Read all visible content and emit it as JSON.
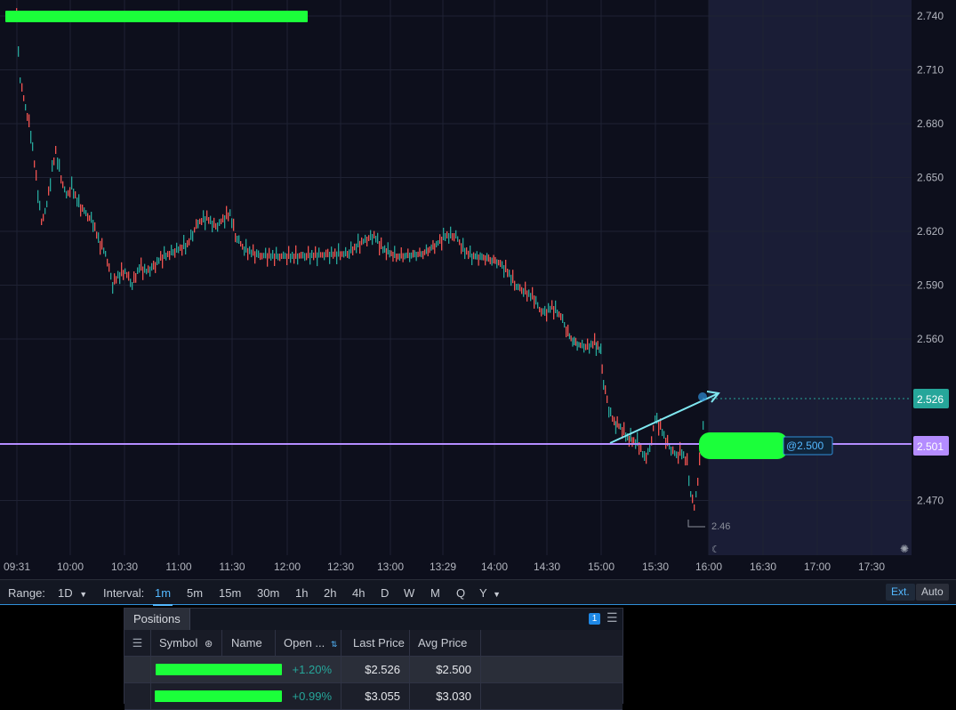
{
  "chart": {
    "price_axis": [
      "2.740",
      "2.710",
      "2.680",
      "2.650",
      "2.620",
      "2.590",
      "2.560",
      "2.470"
    ],
    "time_axis": [
      "09:31",
      "10:00",
      "10:30",
      "11:00",
      "11:30",
      "12:00",
      "12:30",
      "13:00",
      "13:29",
      "14:00",
      "14:30",
      "15:00",
      "15:30",
      "16:00",
      "16:30",
      "17:00",
      "17:30"
    ],
    "last_price_badge": "2.526",
    "order_line_badge": "2.501",
    "order_label": "@2.500",
    "low_marker": "2.46",
    "colors": {
      "up": "#26a69a",
      "down": "#ef5350",
      "order_line": "#b48cff",
      "last_price": "#26a69a",
      "arrow": "#7fe7f0",
      "background": "#0d0f1c",
      "extended_hours": "#1a1d36"
    }
  },
  "controls": {
    "range_label": "Range:",
    "range_value": "1D",
    "interval_label": "Interval:",
    "intervals": [
      "1m",
      "5m",
      "15m",
      "30m",
      "1h",
      "2h",
      "4h",
      "D",
      "W",
      "M",
      "Q",
      "Y"
    ],
    "active_interval": "1m",
    "ext_label": "Ext.",
    "auto_label": "Auto"
  },
  "positions": {
    "tab_label": "Positions",
    "count": "1",
    "columns": [
      "Symbol",
      "Name",
      "Open ...",
      "Last Price",
      "Avg Price"
    ],
    "rows": [
      {
        "open_pct": "+1.20%",
        "last_price": "$2.526",
        "avg_price": "$2.500"
      },
      {
        "open_pct": "+0.99%",
        "last_price": "$3.055",
        "avg_price": "$3.030"
      }
    ]
  }
}
